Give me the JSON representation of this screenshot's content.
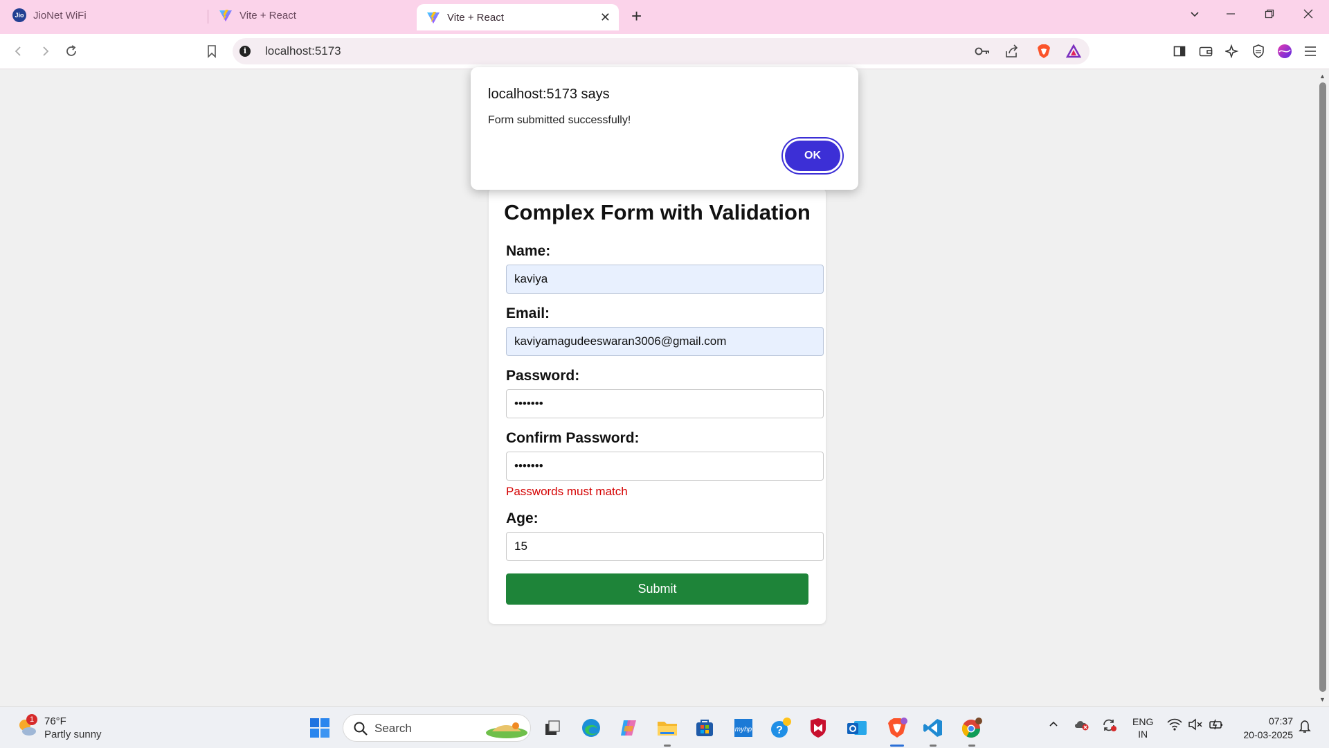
{
  "browser": {
    "tabs": [
      {
        "title": "JioNet WiFi",
        "favicon": "jio-icon"
      },
      {
        "title": "Vite + React",
        "favicon": "vite-icon"
      },
      {
        "title": "Vite + React",
        "favicon": "vite-icon",
        "active": true
      }
    ],
    "url": "localhost:5173",
    "theme_color": "#fbd3ea"
  },
  "dialog": {
    "title": "localhost:5173 says",
    "message": "Form submitted successfully!",
    "ok_label": "OK",
    "ok_color": "#3c2fd6"
  },
  "form": {
    "title": "Complex Form with Validation",
    "name_label": "Name:",
    "name_value": "kaviya",
    "email_label": "Email:",
    "email_value": "kaviyamagudeeswaran3006@gmail.com",
    "password_label": "Password:",
    "password_value": "•••••••",
    "confirm_label": "Confirm Password:",
    "confirm_value": "•••••••",
    "confirm_error": "Passwords must match",
    "age_label": "Age:",
    "age_value": "15",
    "submit_label": "Submit",
    "submit_color": "#1e8439",
    "error_color": "#d40000"
  },
  "taskbar": {
    "weather_temp": "76°F",
    "weather_condition": "Partly sunny",
    "weather_badge": "1",
    "search_label": "Search",
    "lang_line1": "ENG",
    "lang_line2": "IN",
    "time": "07:37",
    "date": "20-03-2025"
  }
}
